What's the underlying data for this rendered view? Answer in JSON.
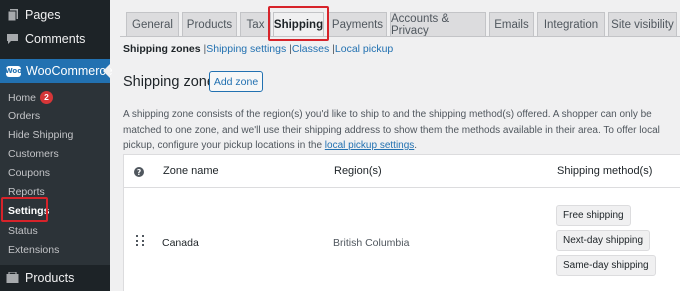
{
  "sidebar": {
    "top_items": [
      {
        "label": "Pages",
        "icon": "pages-icon"
      },
      {
        "label": "Comments",
        "icon": "comments-icon"
      }
    ],
    "woocommerce": {
      "label": "WooCommerce",
      "logo_text": "Woo"
    },
    "submenu": [
      {
        "label": "Home",
        "badge": "2"
      },
      {
        "label": "Orders"
      },
      {
        "label": "Hide Shipping"
      },
      {
        "label": "Customers"
      },
      {
        "label": "Coupons"
      },
      {
        "label": "Reports"
      },
      {
        "label": "Settings",
        "active": true
      },
      {
        "label": "Status"
      },
      {
        "label": "Extensions"
      }
    ],
    "products": {
      "label": "Products"
    }
  },
  "tabs": [
    {
      "label": "General"
    },
    {
      "label": "Products"
    },
    {
      "label": "Tax"
    },
    {
      "label": "Shipping",
      "active": true
    },
    {
      "label": "Payments"
    },
    {
      "label": "Accounts & Privacy"
    },
    {
      "label": "Emails"
    },
    {
      "label": "Integration"
    },
    {
      "label": "Site visibility"
    }
  ],
  "subnav": {
    "current": "Shipping zones",
    "links": [
      "Shipping settings",
      "Classes",
      "Local pickup"
    ],
    "separator": "|"
  },
  "page": {
    "title": "Shipping zones",
    "add_button": "Add zone",
    "description_before": "A shipping zone consists of the region(s) you'd like to ship to and the shipping method(s) offered. A shopper can only be matched to one zone, and we'll use their shipping address to show them the methods available in their area. To offer local pickup, configure your pickup locations in the ",
    "description_link": "local pickup settings",
    "description_after": "."
  },
  "table": {
    "help_glyph": "?",
    "columns": [
      "Zone name",
      "Region(s)",
      "Shipping method(s)"
    ],
    "rows": [
      {
        "zone": "Canada",
        "region": "British Columbia",
        "methods": [
          "Free shipping",
          "Next-day shipping",
          "Same-day shipping"
        ]
      }
    ]
  },
  "colors": {
    "sidebar_bg": "#1d2327",
    "submenu_bg": "#2c3338",
    "accent": "#2271b1",
    "highlight_box": "#d7232a",
    "badge": "#d63638"
  }
}
